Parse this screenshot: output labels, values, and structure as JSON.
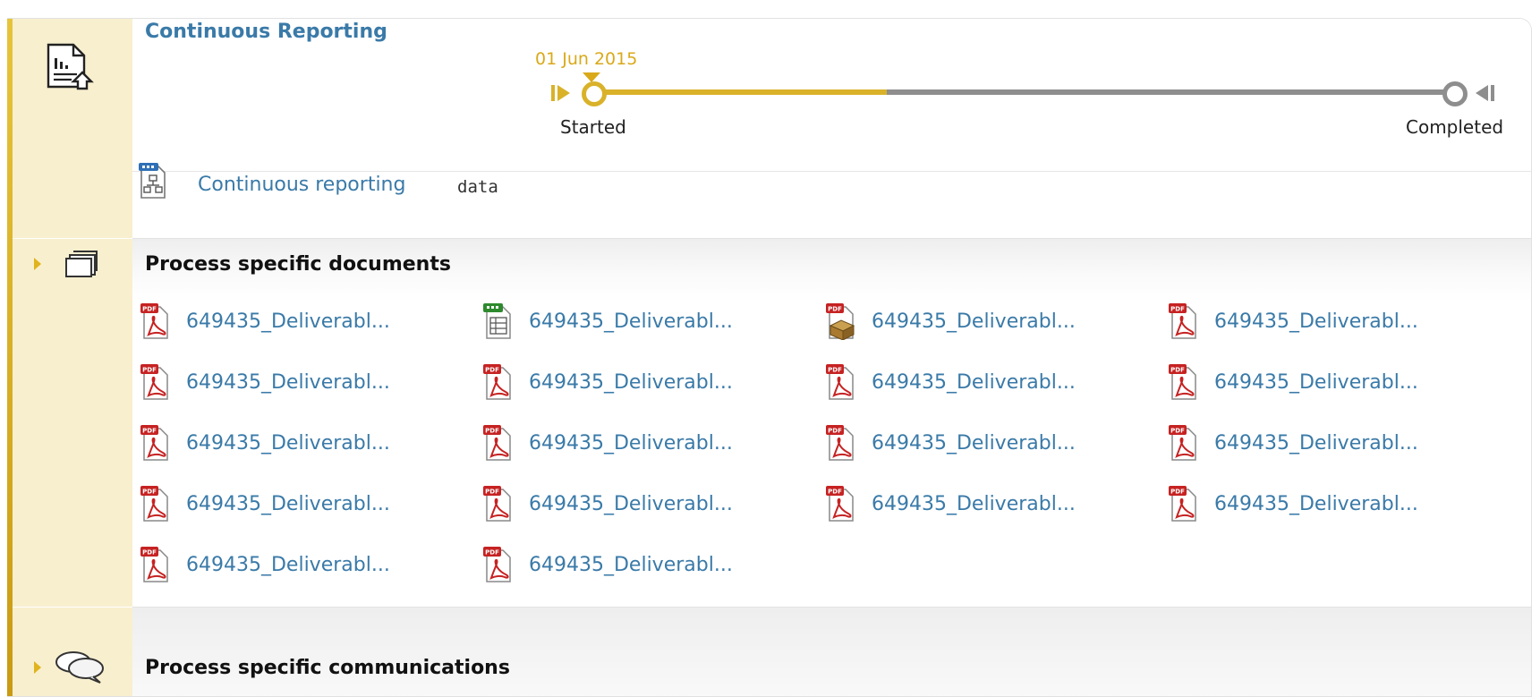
{
  "header": {
    "title": "Continuous Reporting",
    "icon": "report-document-icon"
  },
  "timeline": {
    "date": "01 Jun 2015",
    "start_label": "Started",
    "end_label": "Completed",
    "progress_fraction": 0.34,
    "done_color": "#d9b22a",
    "todo_color": "#8e8e8e"
  },
  "data_link": {
    "label": "Continuous reporting",
    "suffix": "data",
    "icon": "xml-structure-file-icon"
  },
  "documents_section": {
    "title": "Process specific documents",
    "icon": "folder-icon",
    "files": [
      {
        "name": "649435_Deliverabl...",
        "type": "pdf"
      },
      {
        "name": "649435_Deliverabl...",
        "type": "spreadsheet"
      },
      {
        "name": "649435_Deliverabl...",
        "type": "pdf-package"
      },
      {
        "name": "649435_Deliverabl...",
        "type": "pdf"
      },
      {
        "name": "649435_Deliverabl...",
        "type": "pdf"
      },
      {
        "name": "649435_Deliverabl...",
        "type": "pdf"
      },
      {
        "name": "649435_Deliverabl...",
        "type": "pdf"
      },
      {
        "name": "649435_Deliverabl...",
        "type": "pdf"
      },
      {
        "name": "649435_Deliverabl...",
        "type": "pdf"
      },
      {
        "name": "649435_Deliverabl...",
        "type": "pdf"
      },
      {
        "name": "649435_Deliverabl...",
        "type": "pdf"
      },
      {
        "name": "649435_Deliverabl...",
        "type": "pdf"
      },
      {
        "name": "649435_Deliverabl...",
        "type": "pdf"
      },
      {
        "name": "649435_Deliverabl...",
        "type": "pdf"
      },
      {
        "name": "649435_Deliverabl...",
        "type": "pdf"
      },
      {
        "name": "649435_Deliverabl...",
        "type": "pdf"
      },
      {
        "name": "649435_Deliverabl...",
        "type": "pdf"
      },
      {
        "name": "649435_Deliverabl...",
        "type": "pdf"
      }
    ]
  },
  "communications_section": {
    "title": "Process specific communications",
    "icon": "speech-bubbles-icon"
  },
  "colors": {
    "accent": "#e0b41c",
    "link": "#3a7aa8",
    "gutter": "#f8efcf"
  }
}
